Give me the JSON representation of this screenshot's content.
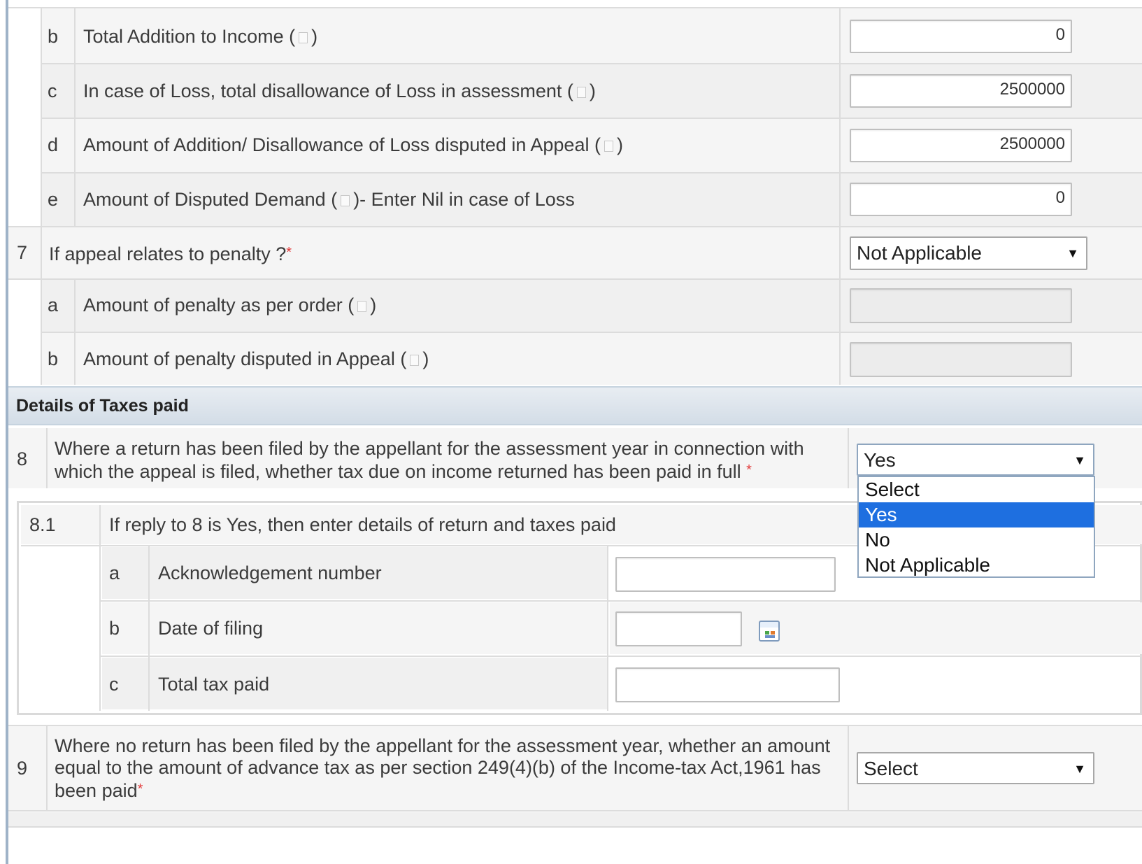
{
  "rows_6": [
    {
      "letter": "b",
      "label": "Total Addition to Income (",
      "label_end": ")",
      "value": "0"
    },
    {
      "letter": "c",
      "label": "In case of Loss, total disallowance of Loss in assessment (",
      "label_end": ")",
      "value": "2500000"
    },
    {
      "letter": "d",
      "label": "Amount of Addition/ Disallowance of Loss disputed in Appeal (",
      "label_end": ")",
      "value": "2500000"
    },
    {
      "letter": "e",
      "label": "Amount of Disputed Demand (",
      "label_end": ")- Enter Nil in case of Loss",
      "value": "0"
    }
  ],
  "q7": {
    "number": "7",
    "label": "If appeal relates to penalty ?",
    "required_mark": "*",
    "selected": "Not Applicable",
    "sub": [
      {
        "letter": "a",
        "label": "Amount of penalty as per order (",
        "label_end": ")",
        "value": ""
      },
      {
        "letter": "b",
        "label": "Amount of penalty disputed in Appeal (",
        "label_end": ")",
        "value": ""
      }
    ]
  },
  "section_title": "Details of Taxes paid",
  "q8": {
    "number": "8",
    "label": "Where a return has been filed by the appellant for the assessment year in connection with which the appeal is filed, whether tax due on income returned has been paid in full",
    "required_mark": "*",
    "selected": "Yes",
    "options": [
      "Select",
      "Yes",
      "No",
      "Not Applicable"
    ],
    "highlighted_option": "Yes"
  },
  "q8_1": {
    "number": "8.1",
    "label": "If reply to 8 is Yes, then enter details of return and taxes paid",
    "sub": [
      {
        "letter": "a",
        "label": "Acknowledgement number",
        "value": ""
      },
      {
        "letter": "b",
        "label": "Date of filing",
        "value": "",
        "icon": "calendar-icon"
      },
      {
        "letter": "c",
        "label": "Total tax paid",
        "value": ""
      }
    ]
  },
  "q9": {
    "number": "9",
    "label": "Where no return has been filed by the appellant for the assessment year, whether an amount equal to the amount of advance tax as per section 249(4)(b) of the Income-tax Act,1961 has been paid",
    "required_mark": "*",
    "selected": "Select"
  },
  "colors": {
    "accent_rule": "#9fb3c8",
    "dropdown_highlight": "#1e6fe0",
    "required": "#e23b3b"
  }
}
